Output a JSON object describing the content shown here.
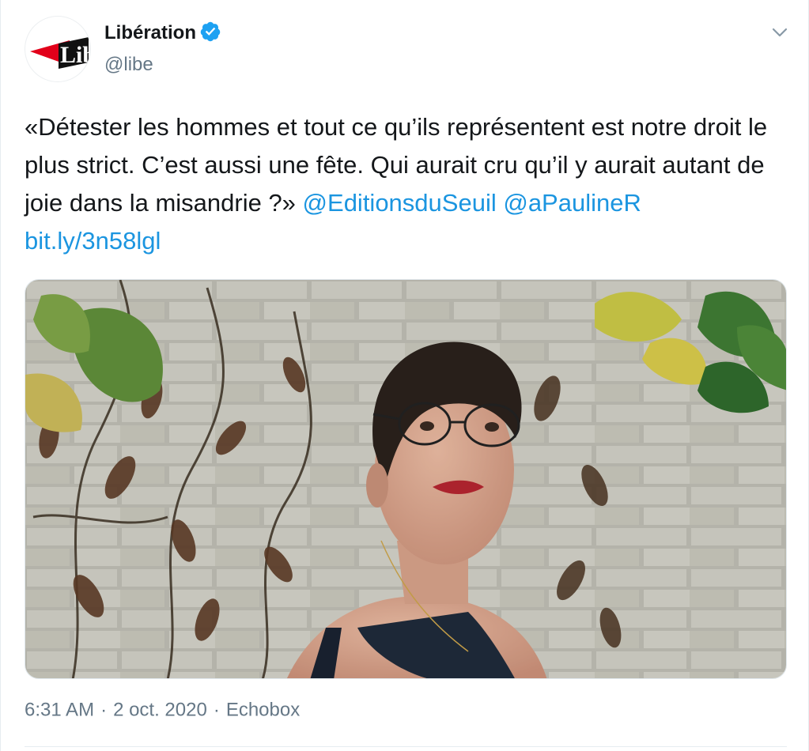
{
  "author": {
    "display_name": "Libération",
    "handle": "@libe",
    "verified": true,
    "avatar_logo_text": "Libé"
  },
  "tweet": {
    "text": "«Détester les hommes et tout ce qu’ils représentent est notre droit le plus strict. C’est aussi une fête. Qui aurait cru qu’il y aurait autant de joie dans la misandrie ?» ",
    "links": [
      {
        "label": "@EditionsduSeuil"
      },
      {
        "label": "@aPaulineR"
      },
      {
        "label": "bit.ly/3n58lgl"
      }
    ]
  },
  "media": {
    "icon": "photo-portrait"
  },
  "meta": {
    "time": "6:31 AM",
    "date": "2 oct. 2020",
    "separator": "·",
    "source": "Echobox"
  },
  "icons": {
    "verified": "verified-badge-icon",
    "menu": "chevron-down-icon"
  },
  "colors": {
    "link": "#1b95e0",
    "verified": "#1da1f2",
    "muted": "#657786",
    "logo_red": "#e2001a"
  }
}
